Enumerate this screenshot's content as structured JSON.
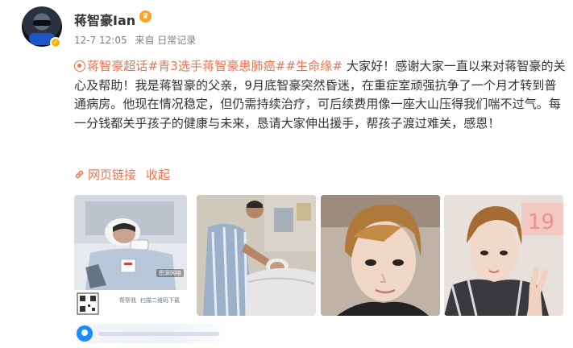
{
  "header": {
    "user_name": "蒋智豪Ian",
    "timestamp": "12-7 12:05",
    "source": "来自 日常记录",
    "badge_color": "#f7b500",
    "vip_color": "#ff9f1a"
  },
  "post": {
    "topics": [
      "蒋智豪超话",
      "#青3选手蒋智豪患肺癌#",
      "#生命缘#"
    ],
    "text": "大家好！感谢大家一直以来对蒋智豪的关心及帮助！我是蒋智豪的父亲，9月底智豪突然昏迷，在重症室顽强抗争了一个月才转到普通病房。他现在情况稳定，但仍需持续治疗，可后续费用像一座大山压得我们喘不过气。每一分钱都关乎孩子的健康与未来，恳请大家伸出援手，帮孩子渡过难关，感恩！",
    "link_label": "网页链接",
    "collapse_label": "收起",
    "accent_color": "#eb7350"
  },
  "images": {
    "img1": {
      "stamp": "图源网络",
      "btn_help": "帮帮我",
      "btn_scan": "扫描二维码下载"
    }
  },
  "location": {
    "icon": "location-pin-icon",
    "color": "#1a8cff"
  }
}
